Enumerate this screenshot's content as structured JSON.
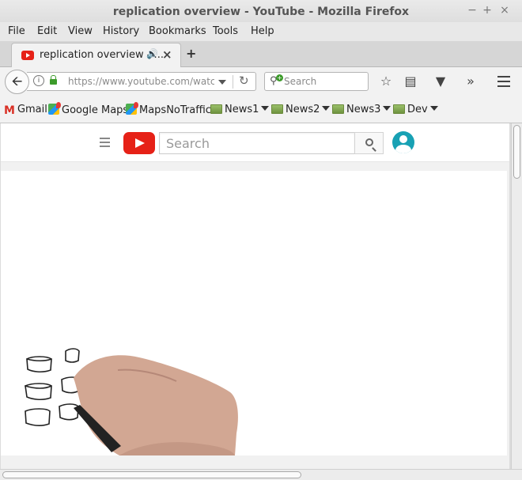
{
  "window": {
    "title": "replication overview - YouTube - Mozilla Firefox",
    "controls": {
      "minimize": "−",
      "maximize": "+",
      "close": "×"
    }
  },
  "menubar": {
    "items": [
      "File",
      "Edit",
      "View",
      "History",
      "Bookmarks",
      "Tools",
      "Help"
    ]
  },
  "tabs": [
    {
      "title": "replication overview - ...",
      "active": true,
      "audio_icon": "speaker-icon",
      "close": "×"
    }
  ],
  "new_tab": "+",
  "navbar": {
    "url_domain": "https://www.youtube.com",
    "url_path": "/watch?",
    "search_placeholder": "Search"
  },
  "bookmarks": [
    {
      "label": "Gmail",
      "icon": "gmail-icon"
    },
    {
      "label": "Google Maps",
      "icon": "maps-icon"
    },
    {
      "label": "MapsNoTraffic",
      "icon": "maps-icon"
    },
    {
      "label": "News1",
      "icon": "folder-icon",
      "folder": true
    },
    {
      "label": "News2",
      "icon": "folder-icon",
      "folder": true
    },
    {
      "label": "News3",
      "icon": "folder-icon",
      "folder": true
    },
    {
      "label": "Dev",
      "icon": "folder-icon",
      "folder": true
    }
  ],
  "youtube": {
    "search_placeholder": "Search",
    "logo_color": "#e62117",
    "avatar_color": "#18a1b4"
  }
}
